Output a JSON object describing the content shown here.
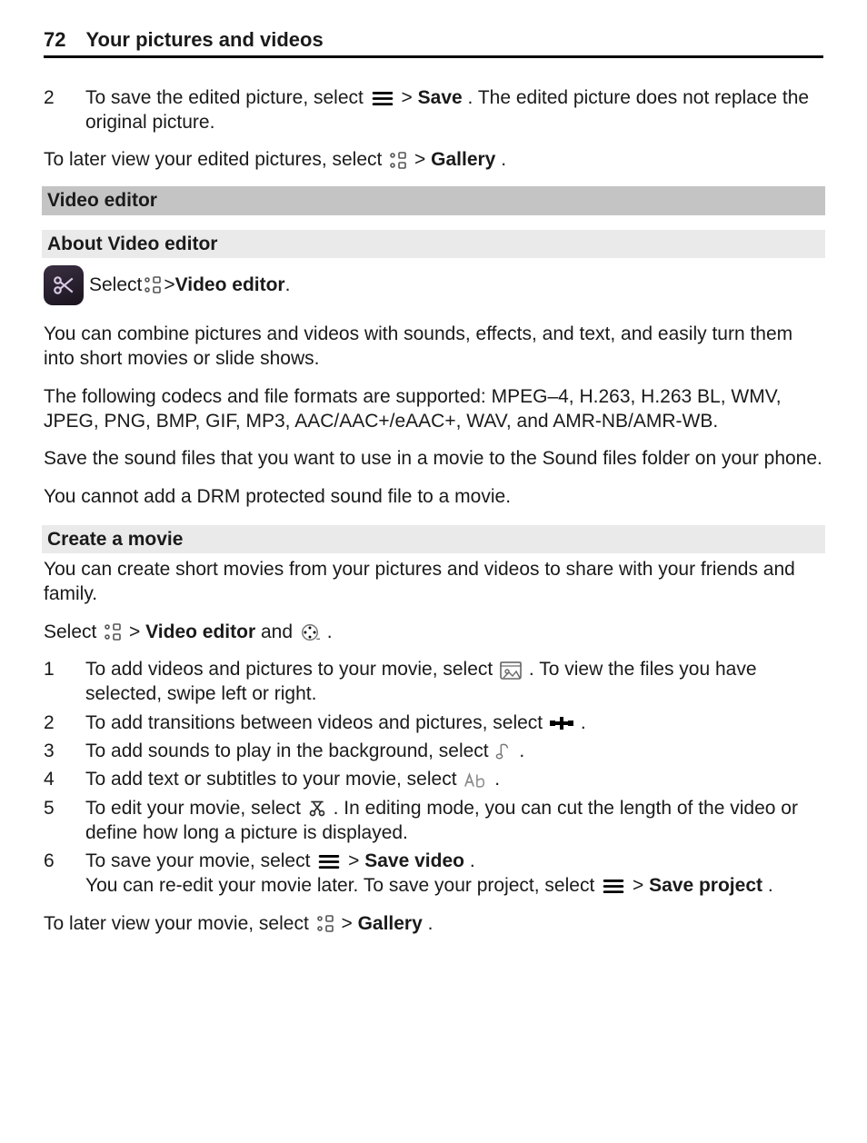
{
  "header": {
    "page_number": "72",
    "title": "Your pictures and videos"
  },
  "save_step": {
    "num": "2",
    "pre": "To save the edited picture, select ",
    "mid": " > ",
    "bold": "Save",
    "post": ". The edited picture does not replace the original picture."
  },
  "later_view": {
    "pre": "To later view your edited pictures, select ",
    "mid": " > ",
    "bold": "Gallery",
    "post": "."
  },
  "section": {
    "title": "Video editor",
    "subtitle": "About Video editor"
  },
  "intro": {
    "pre": "Select ",
    "mid": " > ",
    "bold": "Video editor",
    "post": "."
  },
  "about": {
    "p1": "You can combine pictures and videos with sounds, effects, and text, and easily turn them into short movies or slide shows.",
    "p2": "The following codecs and file formats are supported: MPEG–4, H.263, H.263 BL, WMV, JPEG, PNG, BMP, GIF, MP3, AAC/AAC+/eAAC+, WAV, and AMR-NB/AMR-WB.",
    "p3": "Save the sound files that you want to use in a movie to the Sound files folder on your phone.",
    "p4": "You cannot add a DRM protected sound file to a movie."
  },
  "create": {
    "title": "Create a movie",
    "p1": "You can create short movies from your pictures and videos to share with your friends and family.",
    "nav": {
      "pre": "Select ",
      "mid": " > ",
      "bold": "Video editor",
      "post2": " and ",
      "post3": "."
    },
    "steps": {
      "n1": "1",
      "s1a": "To add videos and pictures to your movie, select ",
      "s1b": ". To view the files you have selected, swipe left or right.",
      "n2": "2",
      "s2a": "To add transitions between videos and pictures, select ",
      "s2b": ".",
      "n3": "3",
      "s3a": "To add sounds to play in the background, select ",
      "s3b": ".",
      "n4": "4",
      "s4a": "To add text or subtitles to your movie, select ",
      "s4b": ".",
      "n5": "5",
      "s5a": "To edit your movie, select ",
      "s5b": ". In editing mode, you can cut the length of the video or define how long a picture is displayed.",
      "n6": "6",
      "s6a": "To save your movie, select ",
      "s6mid": " > ",
      "s6bold": "Save video",
      "s6b": ".",
      "s6c": "You can re-edit your movie later. To save your project, select ",
      "s6cmid": " > ",
      "s6cbold": "Save project",
      "s6cpost": "."
    },
    "later": {
      "pre": "To later view your movie, select ",
      "mid": " > ",
      "bold": "Gallery",
      "post": "."
    }
  }
}
